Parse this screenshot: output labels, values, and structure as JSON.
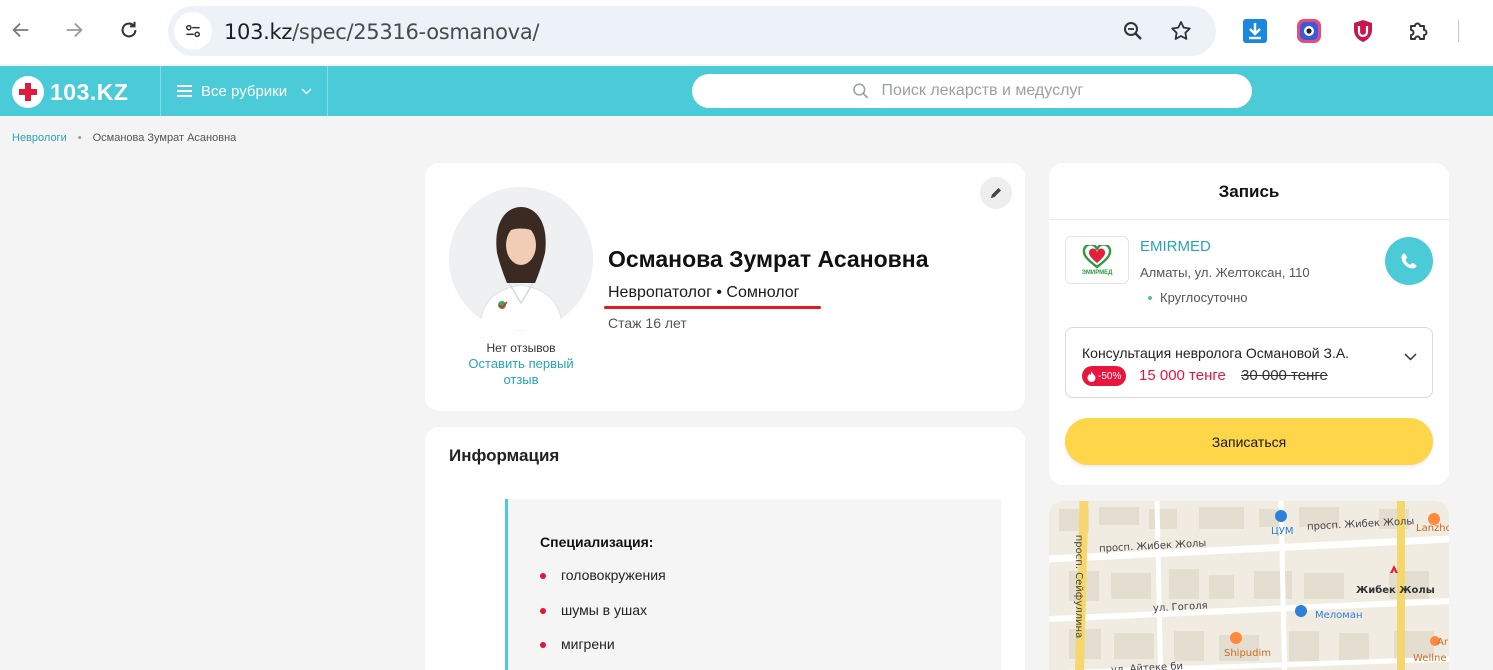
{
  "browser": {
    "url_host": "103.kz",
    "url_path": "/spec/25316-osmanova/"
  },
  "header": {
    "logo_text": "103.KZ",
    "rubrics_label": "Все рубрики",
    "search_placeholder": "Поиск лекарств и медуслуг",
    "accent_color": "#4bcad7"
  },
  "breadcrumbs": {
    "parent": "Неврологи",
    "separator": "•",
    "current": "Османова Зумрат Асановна"
  },
  "doctor": {
    "name": "Османова Зумрат Асановна",
    "specialties": "Невропатолог • Сомнолог",
    "experience": "Стаж 16 лет",
    "reviews_status": "Нет отзывов",
    "first_review_link": "Оставить первый отзыв"
  },
  "info": {
    "title": "Информация",
    "specialization_label": "Специализация:",
    "items": [
      "головокружения",
      "шумы в ушах",
      "мигрени"
    ]
  },
  "booking": {
    "title": "Запись",
    "clinic_name": "EMIRMED",
    "clinic_logo_text": "ЭМИРМЕД",
    "clinic_address": "Алматы, ул. Желтоксан, 110",
    "clinic_hours": "Круглосуточно",
    "service": {
      "name": "Консультация невролога Османовой З.А.",
      "discount": "-50%",
      "price_new": "15 000 тенге",
      "price_old": "30 000 тенге"
    },
    "book_button": "Записаться",
    "button_color": "#ffd54a",
    "discount_color": "#e8163f"
  },
  "map": {
    "labels": {
      "zhibek1": "просп. Жибек Жолы",
      "zhibek2": "просп. Жибек Жолы",
      "seifullin": "просп. Сейфуллина",
      "tsum": "ЦУМ",
      "lanzhou": "Lanzho",
      "zhibek_metro": "Жибек Жолы",
      "gogol": "ул. Гоголя",
      "meloman": "Меломан",
      "shipudim": "Shipudim",
      "aiteke": "ул. Айтеке би",
      "wellness": "Wellne",
      "ar": "Ar"
    }
  }
}
